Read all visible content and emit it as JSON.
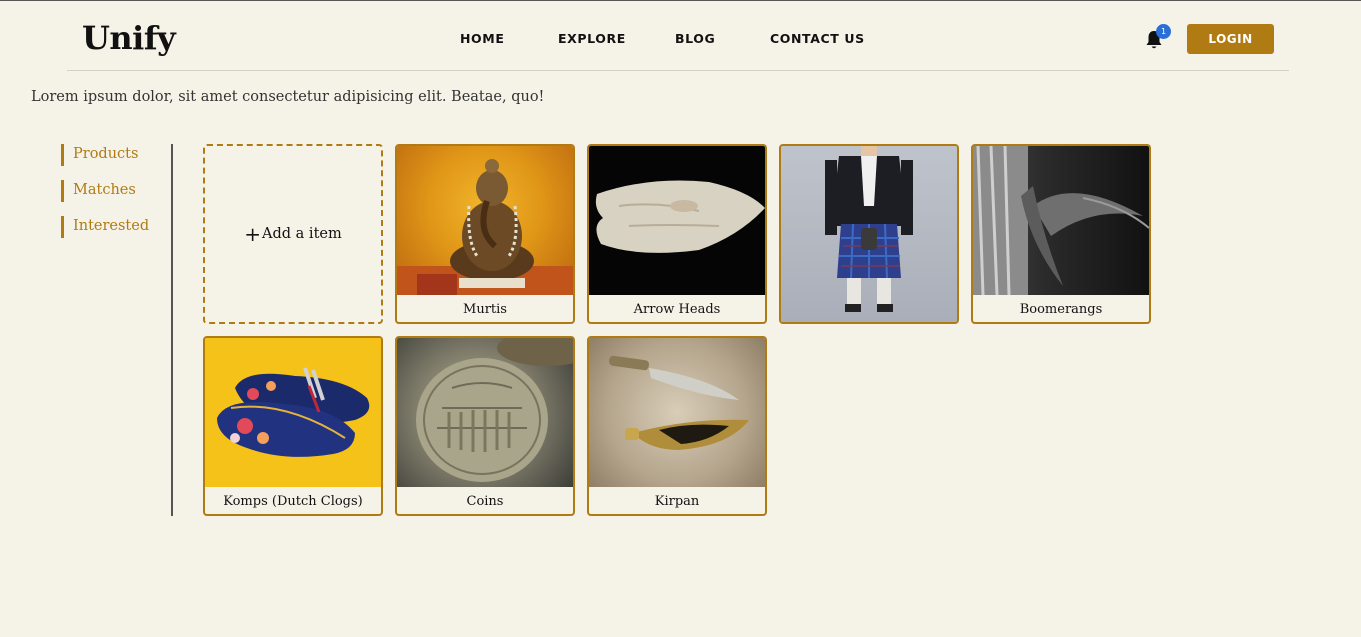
{
  "header": {
    "logo": "Unify",
    "nav": [
      "HOME",
      "EXPLORE",
      "BLOG",
      "CONTACT US"
    ],
    "notification_count": "1",
    "login_label": "LOGIN"
  },
  "intro_text": "Lorem ipsum dolor, sit amet consectetur adipisicing elit. Beatae, quo!",
  "sidebar": {
    "items": [
      {
        "label": "Products"
      },
      {
        "label": "Matches"
      },
      {
        "label": "Interested"
      }
    ]
  },
  "grid": {
    "add_label": "Add a item",
    "items": [
      {
        "caption": "Murtis"
      },
      {
        "caption": "Arrow Heads"
      },
      {
        "caption": ""
      },
      {
        "caption": "Boomerangs"
      },
      {
        "caption": "Komps (Dutch Clogs)"
      },
      {
        "caption": "Coins"
      },
      {
        "caption": "Kirpan"
      }
    ]
  },
  "colors": {
    "accent": "#b07b12",
    "background": "#f5f2e7",
    "badge": "#2a6fd6"
  }
}
